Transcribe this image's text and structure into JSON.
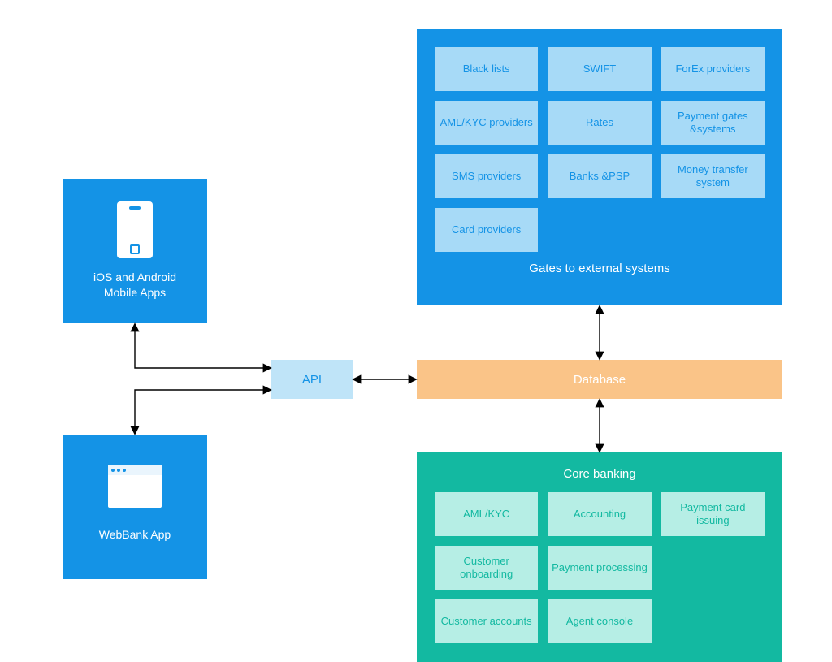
{
  "mobile_tile": {
    "caption_line1": "iOS and Android",
    "caption_line2": "Mobile Apps"
  },
  "web_tile": {
    "caption": "WebBank App"
  },
  "api": {
    "label": "API"
  },
  "database": {
    "label": "Database"
  },
  "external": {
    "title": "Gates to external systems",
    "chips": [
      "Black lists",
      "SWIFT",
      "ForEx providers",
      "AML/KYC providers",
      "Rates",
      "Payment gates &systems",
      "SMS providers",
      "Banks &PSP",
      "Money transfer system",
      "Card providers"
    ]
  },
  "core": {
    "title": "Core banking",
    "chips": [
      "AML/KYC",
      "Accounting",
      "Payment card issuing",
      "Customer onboarding",
      "Payment processing",
      "",
      "Customer accounts",
      "Agent console",
      ""
    ]
  }
}
